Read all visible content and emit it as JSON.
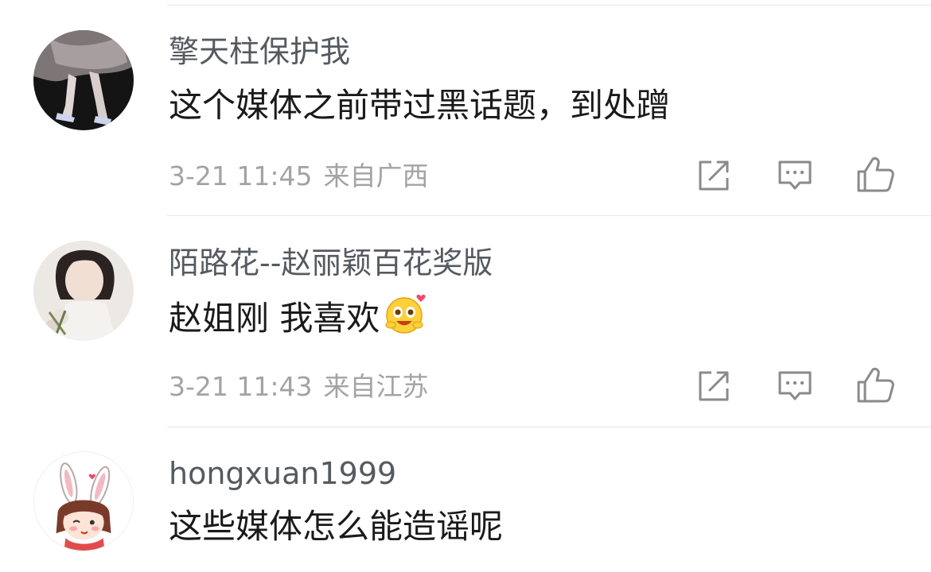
{
  "colors": {
    "username": "#555a60",
    "content": "#1a1a1a",
    "meta": "#a3a3a3",
    "icon": "#8a8a8a",
    "divider": "#e6e6e6"
  },
  "comments": [
    {
      "username": "擎天柱保护我",
      "content": "这个媒体之前带过黑话题，到处蹭",
      "time": "3-21 11:45",
      "location": "来自广西",
      "avatar": "photo-legs-dress-avatar"
    },
    {
      "username": "陌路花--赵丽颖百花奖版",
      "content": "赵姐刚 我喜欢",
      "emoji": "happy-face-emoji",
      "time": "3-21 11:43",
      "location": "来自江苏",
      "avatar": "photo-woman-flowers-avatar"
    },
    {
      "username": "hongxuan1999",
      "content": "这些媒体怎么能造谣呢",
      "avatar": "cartoon-bunny-girl-avatar"
    }
  ],
  "actions": {
    "share_icon": "share-icon",
    "reply_icon": "comment-icon",
    "like_icon": "thumbs-up-icon"
  }
}
